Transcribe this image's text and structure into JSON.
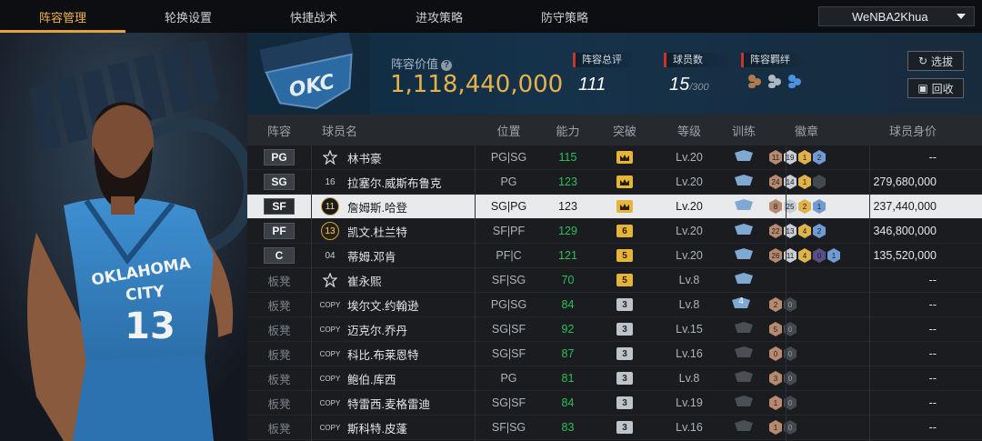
{
  "nav": {
    "tabs": [
      "阵容管理",
      "轮换设置",
      "快捷战术",
      "进攻策略",
      "防守策略"
    ],
    "active_index": 0,
    "account": "WeNBA2Khua"
  },
  "header": {
    "value_label": "阵容价值",
    "value": "1,118,440,000",
    "stats": [
      {
        "label": "阵容总评",
        "value": "111",
        "suffix": ""
      },
      {
        "label": "球员数",
        "value": "15",
        "suffix": "/300"
      },
      {
        "label": "阵容羁绊",
        "value": "",
        "suffix": ""
      }
    ],
    "buttons": {
      "scout": "选拔",
      "recycle": "回收"
    }
  },
  "table": {
    "headers": [
      "阵容",
      "球员名",
      "位置",
      "能力",
      "突破",
      "等级",
      "训练",
      "徽章",
      "球员身价"
    ],
    "rows": [
      {
        "role": "PG",
        "starter": true,
        "num": "",
        "name": "林书豪",
        "pos": "PG|SG",
        "abil": "115",
        "brk": "",
        "brk_style": "gold",
        "lv": "Lv.20",
        "train": "",
        "badges": [
          "11",
          "19",
          "1",
          "2"
        ],
        "badge_colors": [
          "br",
          "sv",
          "gd",
          "bl"
        ],
        "value": "--"
      },
      {
        "role": "SG",
        "starter": true,
        "num": "16",
        "name": "拉塞尔.威斯布鲁克",
        "pos": "PG",
        "abil": "123",
        "brk": "",
        "brk_style": "gold",
        "lv": "Lv.20",
        "train": "",
        "badges": [
          "24",
          "14",
          "1",
          ""
        ],
        "badge_colors": [
          "br",
          "sv",
          "gd",
          ""
        ],
        "value": "279,680,000"
      },
      {
        "role": "SF",
        "starter": true,
        "num": "11",
        "name": "詹姆斯.哈登",
        "pos": "SG|PG",
        "abil": "123",
        "brk": "",
        "brk_style": "gold",
        "lv": "Lv.20",
        "train": "",
        "badges": [
          "8",
          "25",
          "2",
          "1"
        ],
        "badge_colors": [
          "br",
          "sv",
          "gd",
          "bl"
        ],
        "value": "237,440,000",
        "selected": true
      },
      {
        "role": "PF",
        "starter": true,
        "num": "13",
        "name": "凯文.杜兰特",
        "pos": "SF|PF",
        "abil": "129",
        "brk": "6",
        "brk_style": "gold",
        "lv": "Lv.20",
        "train": "",
        "badges": [
          "22",
          "13",
          "4",
          "2"
        ],
        "badge_colors": [
          "br",
          "sv",
          "gd",
          "bl"
        ],
        "value": "346,800,000"
      },
      {
        "role": "C",
        "starter": true,
        "num": "04",
        "name": "蒂姆.邓肯",
        "pos": "PF|C",
        "abil": "121",
        "brk": "5",
        "brk_style": "gold",
        "lv": "Lv.20",
        "train": "",
        "badges": [
          "26",
          "11",
          "4",
          "0",
          "1"
        ],
        "badge_colors": [
          "br",
          "sv",
          "gd",
          "pp",
          "bl"
        ],
        "value": "135,520,000"
      },
      {
        "role": "板凳",
        "starter": false,
        "num": "",
        "name": "崔永熙",
        "pos": "SF|SG",
        "abil": "70",
        "brk": "5",
        "brk_style": "gold",
        "lv": "Lv.8",
        "train": "",
        "badges": [],
        "badge_colors": [],
        "value": "--"
      },
      {
        "role": "板凳",
        "starter": false,
        "num": "COPY",
        "name": "埃尔文.约翰逊",
        "pos": "PG|SG",
        "abil": "84",
        "brk": "3",
        "brk_style": "gray",
        "lv": "Lv.8",
        "train": "4",
        "badges": [
          "2",
          "0"
        ],
        "badge_colors": [
          "br",
          "dk"
        ],
        "value": "--"
      },
      {
        "role": "板凳",
        "starter": false,
        "num": "COPY",
        "name": "迈克尔.乔丹",
        "pos": "SG|SF",
        "abil": "92",
        "brk": "3",
        "brk_style": "gray",
        "lv": "Lv.15",
        "train": "",
        "badges": [
          "5",
          "0"
        ],
        "badge_colors": [
          "br",
          "dk"
        ],
        "value": "--"
      },
      {
        "role": "板凳",
        "starter": false,
        "num": "COPY",
        "name": "科比.布莱恩特",
        "pos": "SG|SF",
        "abil": "87",
        "brk": "3",
        "brk_style": "gray",
        "lv": "Lv.16",
        "train": "",
        "badges": [
          "0",
          "0"
        ],
        "badge_colors": [
          "br",
          "dk"
        ],
        "value": "--"
      },
      {
        "role": "板凳",
        "starter": false,
        "num": "COPY",
        "name": "鲍伯.库西",
        "pos": "PG",
        "abil": "81",
        "brk": "3",
        "brk_style": "gray",
        "lv": "Lv.8",
        "train": "",
        "badges": [
          "3",
          "0"
        ],
        "badge_colors": [
          "br",
          "dk"
        ],
        "value": "--"
      },
      {
        "role": "板凳",
        "starter": false,
        "num": "COPY",
        "name": "特雷西.麦格雷迪",
        "pos": "SG|SF",
        "abil": "84",
        "brk": "3",
        "brk_style": "gray",
        "lv": "Lv.19",
        "train": "",
        "badges": [
          "1",
          "0"
        ],
        "badge_colors": [
          "br",
          "dk"
        ],
        "value": "--"
      },
      {
        "role": "板凳",
        "starter": false,
        "num": "COPY",
        "name": "斯科特.皮蓬",
        "pos": "SF|SG",
        "abil": "83",
        "brk": "3",
        "brk_style": "gray",
        "lv": "Lv.16",
        "train": "",
        "badges": [
          "1",
          "0"
        ],
        "badge_colors": [
          "br",
          "dk"
        ],
        "value": "--"
      }
    ]
  },
  "hero": {
    "jersey_team": "OKLAHOMA CITY",
    "jersey_number": "13"
  },
  "logo": {
    "team_text": "OKC"
  },
  "colors": {
    "accent": "#e6a23a",
    "value": "#e8b24b",
    "ability": "#2fbf5a",
    "stat_marker": "#c8332b"
  }
}
